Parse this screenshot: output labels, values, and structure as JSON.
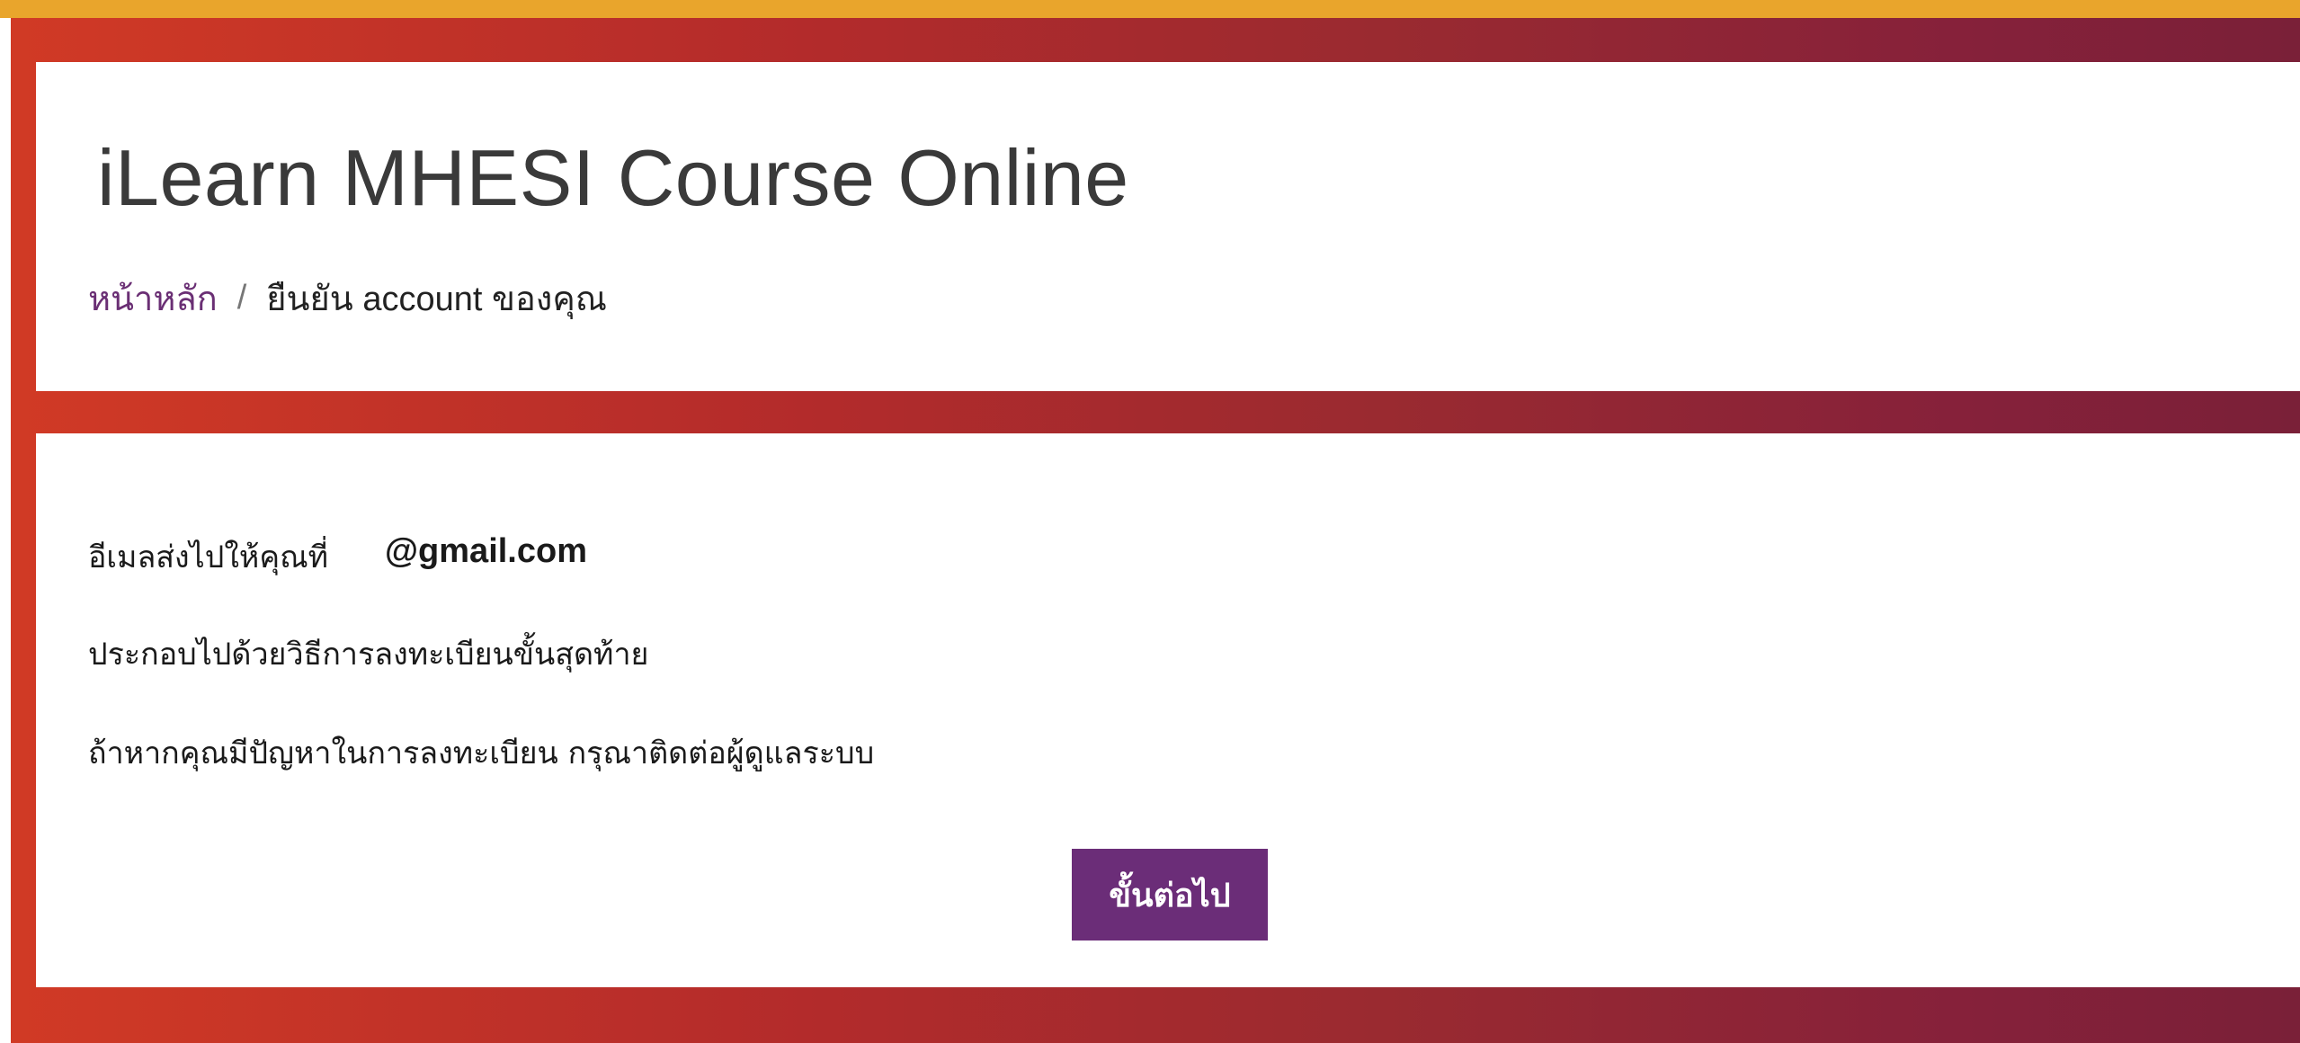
{
  "header": {
    "site_title": "iLearn MHESI Course Online",
    "breadcrumb": {
      "home_label": "หน้าหลัก",
      "separator": "/",
      "current_label": "ยืนยัน account ของคุณ"
    }
  },
  "main": {
    "email_sent_label": "อีเมลส่งไปให้คุณที่",
    "email_value": "@gmail.com",
    "instructions_text": "ประกอบไปด้วยวิธีการลงทะเบียนขั้นสุดท้าย",
    "contact_text": "ถ้าหากคุณมีปัญหาในการลงทะเบียน กรุณาติดต่อผู้ดูแลระบบ",
    "next_button_label": "ขั้นต่อไป"
  },
  "colors": {
    "top_stripe": "#e9a52c",
    "gradient_start": "#d13a25",
    "gradient_end": "#7a2038",
    "button_bg": "#6b2d78",
    "link_color": "#6a2f74"
  }
}
